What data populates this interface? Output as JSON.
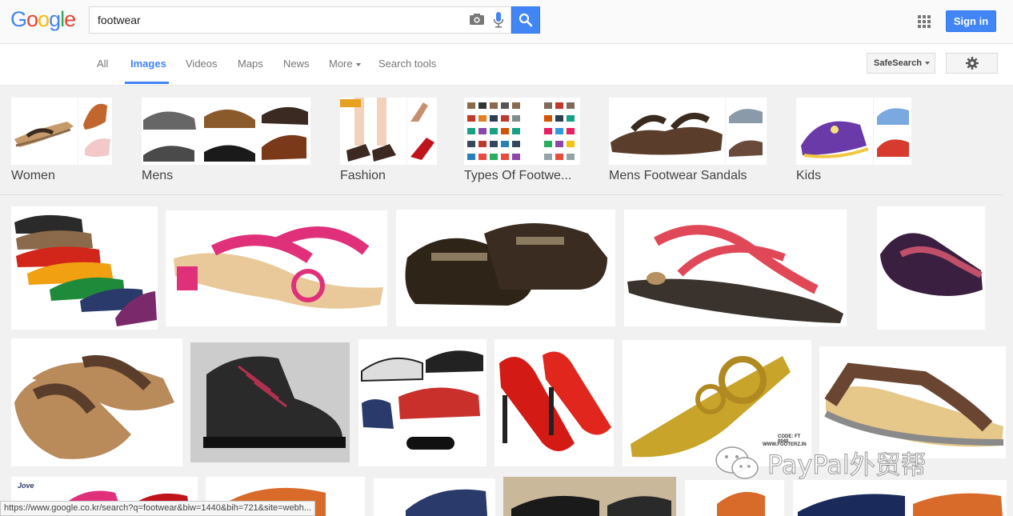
{
  "header": {
    "logo": [
      "G",
      "o",
      "o",
      "g",
      "l",
      "e"
    ],
    "logo_colors": [
      "#4285f4",
      "#ea4335",
      "#fbbc05",
      "#4285f4",
      "#34a853",
      "#ea4335"
    ],
    "query": "footwear",
    "sign_in": "Sign in"
  },
  "tabs": [
    {
      "label": "All"
    },
    {
      "label": "Images"
    },
    {
      "label": "Videos"
    },
    {
      "label": "Maps"
    },
    {
      "label": "News"
    },
    {
      "label": "More"
    },
    {
      "label": "Search tools"
    }
  ],
  "safe_search": "SafeSearch",
  "related": [
    {
      "label": "Women"
    },
    {
      "label": "Mens"
    },
    {
      "label": "Fashion"
    },
    {
      "label": "Types Of Footwe..."
    },
    {
      "label": "Mens Footwear Sandals"
    },
    {
      "label": "Kids"
    }
  ],
  "image_labels": {
    "code_label": "CODE: FT 0040",
    "site_label": "WWW.FOOTERZ.IN",
    "brand_label": "Jove"
  },
  "status_url": "https://www.google.co.kr/search?q=footwear&biw=1440&bih=721&site=webh...",
  "watermark": "PayPal外贸帮",
  "colors": {
    "accent": "#4285f4",
    "active_tab": "#4285f4"
  }
}
